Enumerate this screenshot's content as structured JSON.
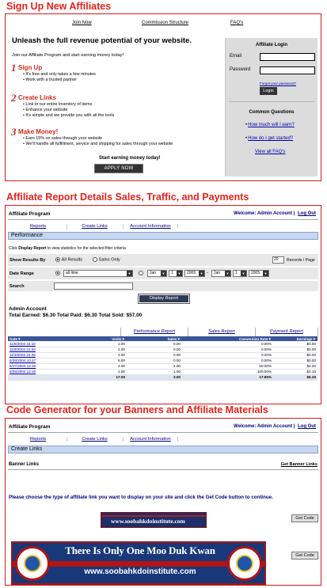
{
  "sections": {
    "s1": "Sign Up New Affiliates",
    "s2": "Affiliate Report Details Sales, Traffic, and Payments",
    "s3": "Code Generator for your Banners and Affiliate Materials"
  },
  "signup": {
    "nav": [
      "Join Now",
      "Commission Structure",
      "FAQ's"
    ],
    "headline": "Unleash the full revenue potential of your website.",
    "intro": "Join our Affiliate Program and start earning money today!",
    "steps": [
      {
        "num": "1",
        "title": "Sign Up",
        "bullets": [
          "It's free and only takes a few minutes",
          "Work with a trusted partner"
        ]
      },
      {
        "num": "2",
        "title": "Create Links",
        "bullets": [
          "Link to our entire inventory of items",
          "Enhance your website",
          "It's simple and we provide you with all the tools"
        ]
      },
      {
        "num": "3",
        "title": "Make Money!",
        "bullets": [
          "Earn 15% on sales through your website",
          "We'll handle all fulfillment, service and shipping for sales through your website"
        ]
      }
    ],
    "start_text": "Start earning money today!",
    "apply_label": "APPLY NOW",
    "login": {
      "title": "Affiliate Login",
      "email_label": "Email",
      "password_label": "Password",
      "forgot": "Forgot your password?",
      "button": "Login"
    },
    "questions": {
      "title": "Common Questions",
      "items": [
        "How much will I earn?",
        "How do I get started?"
      ],
      "view_all": "View all FAQ's"
    }
  },
  "report": {
    "app_title": "Affiliate Program",
    "welcome": "Welcome: Admin Account",
    "sep": "|",
    "logout": "Log Out",
    "tabs": [
      "Reports",
      "Create Links",
      "Account Information"
    ],
    "section_title": "Performance",
    "hint_pre": "Click ",
    "hint_bold": "Display Report",
    "hint_post": " to view statistics for the selected filter criteria",
    "show_label": "Show Results By",
    "opt_all": "All Results",
    "opt_sales": "Sales Only",
    "records_value": "20",
    "records_label": "Records / Page",
    "date_label": "Date Range",
    "date_sel": "all time",
    "from": {
      "m": "Jan",
      "d": "1",
      "y": "2005"
    },
    "dash": "-",
    "to": {
      "m": "Jan",
      "d": "1",
      "y": "2005"
    },
    "search_label": "Search",
    "display_btn": "Display Report",
    "account": "Admin Account",
    "totals": "Total Earned: $6.30  Total Paid: $6.30  Total Sold: $57.00",
    "report_tabs": [
      "Performance Report",
      "Sales Report",
      "Payment Report"
    ],
    "columns": [
      "Date▼",
      "Visits▼",
      "Sales▼",
      "Conversion Rate▼",
      "Earnings▼"
    ],
    "rows": [
      [
        "11/9/2004 15:10",
        "1.00",
        "0.00",
        "0.00%",
        "$0.00"
      ],
      [
        "11/8/2004 21:53",
        "2.00",
        "0.00",
        "0.00%",
        "$0.00"
      ],
      [
        "11/3/2004 23:36",
        "3.00",
        "0.00",
        "0.00%",
        "$0.00"
      ],
      [
        "6/28/2004 10:47",
        "6.00",
        "0.00",
        "0.00%",
        "$0.00"
      ],
      [
        "5/27/2004 12:40",
        "4.00",
        "2.00",
        "50.00%",
        "$4.20"
      ],
      [
        "5/26/2004 12:40",
        "1.00",
        "1.00",
        "100.00%",
        "$2.10"
      ]
    ],
    "total_row": [
      "",
      "17.00",
      "3.00",
      "17.65%",
      "$6.30"
    ]
  },
  "codegen": {
    "app_title": "Affiliate Program",
    "welcome": "Welcome: Admin Account",
    "sep": "|",
    "logout": "Log Out",
    "tabs": [
      "Reports",
      "Create Links",
      "Account Information"
    ],
    "section_title": "Create Links",
    "banner_links": "Banner Links",
    "get_banner_links": "Get Banner Links",
    "instruction": "Please choose the type of affiliate link you want to display on your site and click the Get Code button to continue.",
    "getcode": "Get Code",
    "banner1_text": "www.soobahkdoinstitute.com",
    "banner2_line1": "There Is Only One Moo Duk Kwan",
    "banner2_line2": "www.soobahkdoinstitute.com"
  }
}
